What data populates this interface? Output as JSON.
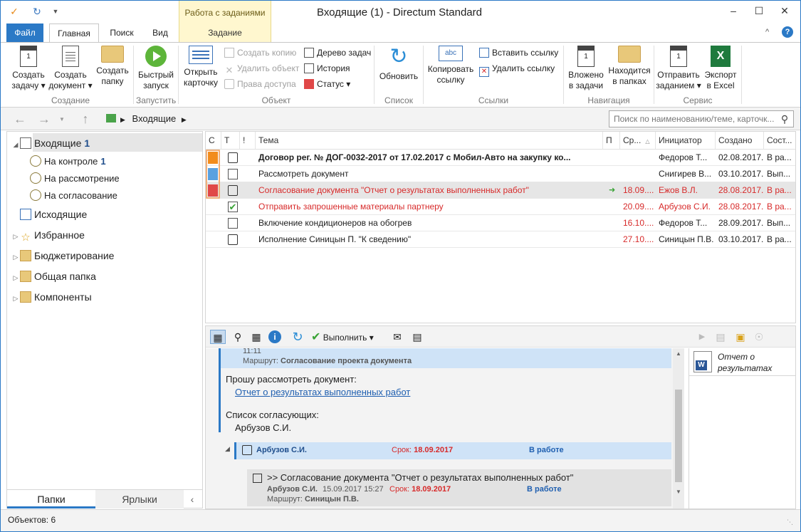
{
  "window": {
    "title": "Входящие (1) - Directum Standard",
    "context_tab_title": "Работа с заданиями",
    "context_tab_sub": "Задание",
    "minimize": "–",
    "maximize": "☐",
    "close": "✕",
    "collapse": "^",
    "help": "?"
  },
  "tabs": {
    "file": "Файл",
    "home": "Главная",
    "search": "Поиск",
    "view": "Вид"
  },
  "ribbon": {
    "create_task": "Создать задачу ▾",
    "create_doc": "Создать документ ▾",
    "create_folder": "Создать папку",
    "group_create": "Создание",
    "quick_run": "Быстрый запуск",
    "group_run": "Запустить",
    "open_card": "Открыть карточку",
    "create_copy": "Создать копию",
    "delete_object": "Удалить объект",
    "access_rights": "Права доступа",
    "task_tree": "Дерево задач",
    "history": "История",
    "status": "Статус ▾",
    "group_object": "Объект",
    "refresh": "Обновить",
    "group_list": "Список",
    "copy_link": "Копировать ссылку",
    "paste_link": "Вставить ссылку",
    "delete_link": "Удалить ссылку",
    "group_links": "Ссылки",
    "attached_to_tasks": "Вложено в задачи",
    "in_folders": "Находится в папках",
    "group_navigation": "Навигация",
    "send_task": "Отправить заданием ▾",
    "export_excel": "Экспорт в Excel",
    "group_service": "Сервис"
  },
  "nav": {
    "back": "←",
    "forward": "→",
    "up": "↑",
    "crumb": "Входящие",
    "search_placeholder": "Поиск по наименованию/теме, карточк..."
  },
  "sidebar": {
    "items": [
      {
        "label": "Входящие",
        "count": "1"
      },
      {
        "label": "На контроле",
        "count": "1"
      },
      {
        "label": "На рассмотрение",
        "count": ""
      },
      {
        "label": "На согласование",
        "count": ""
      },
      {
        "label": "Исходящие",
        "count": ""
      },
      {
        "label": "Избранное",
        "count": ""
      },
      {
        "label": "Бюджетирование",
        "count": ""
      },
      {
        "label": "Общая папка",
        "count": ""
      },
      {
        "label": "Компоненты",
        "count": ""
      }
    ],
    "tab_folders": "Папки",
    "tab_labels": "Ярлыки"
  },
  "grid": {
    "headers": {
      "c": "С",
      "t": "Т",
      "excl": "!",
      "subject": "Тема",
      "p": "П",
      "due": "Ср...",
      "initiator": "Инициатор",
      "created": "Создано",
      "state": "Сост..."
    },
    "rows": [
      {
        "subject": "Договор рег. № ДОГ-0032-2017 от 17.02.2017 с Мобил-Авто на закупку ко...",
        "due": "",
        "initiator": "Федоров Т...",
        "created": "02.08.2017...",
        "state": "В ра...",
        "prio_color": "#f28c1c",
        "style": "bold",
        "type": "task"
      },
      {
        "subject": "Рассмотреть документ",
        "due": "",
        "initiator": "Снигирев В...",
        "created": "03.10.2017...",
        "state": "Вып...",
        "prio_color": "#5aa1e0",
        "style": "normal",
        "type": "doc"
      },
      {
        "subject": "Согласование документа \"Отчет о результатах выполненных работ\"",
        "due": "18.09....",
        "initiator": "Ежов В.Л.",
        "created": "28.08.2017...",
        "state": "В ра...",
        "prio_color": "#e04848",
        "style": "red",
        "type": "task"
      },
      {
        "subject": "Отправить запрошенные материалы партнеру",
        "due": "20.09....",
        "initiator": "Арбузов С.И.",
        "created": "28.08.2017...",
        "state": "В ра...",
        "prio_color": "",
        "style": "red",
        "type": "done"
      },
      {
        "subject": "Включение кондиционеров на обогрев",
        "due": "16.10....",
        "initiator": "Федоров Т...",
        "created": "28.09.2017...",
        "state": "Вып...",
        "prio_color": "",
        "style": "normal",
        "type": "doc"
      },
      {
        "subject": "Исполнение Синицын П. \"К сведению\"",
        "due": "27.10....",
        "initiator": "Синицын П.В.",
        "created": "03.10.2017...",
        "state": "В ра...",
        "prio_color": "",
        "style": "normal",
        "type": "task"
      }
    ]
  },
  "preview": {
    "execute": "Выполнить ▾",
    "time_top": "11:11",
    "route_label": "Маршрут:",
    "route_value": "Согласование проекта документа",
    "request": "Прошу рассмотреть документ:",
    "doc_link": "Отчет о результатах выполненных работ",
    "approvers_title": "Список согласующих:",
    "approver": "Арбузов С.И.",
    "assignee": "Арбузов С.И.",
    "due_label": "Срок:",
    "due_value": "18.09.2017",
    "state": "В работе",
    "sub_title": ">> Согласование документа \"Отчет о результатах выполненных работ\"",
    "sub_author": "Арбузов С.И.",
    "sub_time": "15.09.2017 15:27",
    "sub_due_label": "Срок:",
    "sub_due_value": "18.09.2017",
    "sub_state": "В работе",
    "sub_route_label": "Маршрут:",
    "sub_route_value": "Синицын П.В.",
    "attachment": "Отчет о результатах выпол..."
  },
  "status": {
    "objects": "Объектов: 6"
  }
}
